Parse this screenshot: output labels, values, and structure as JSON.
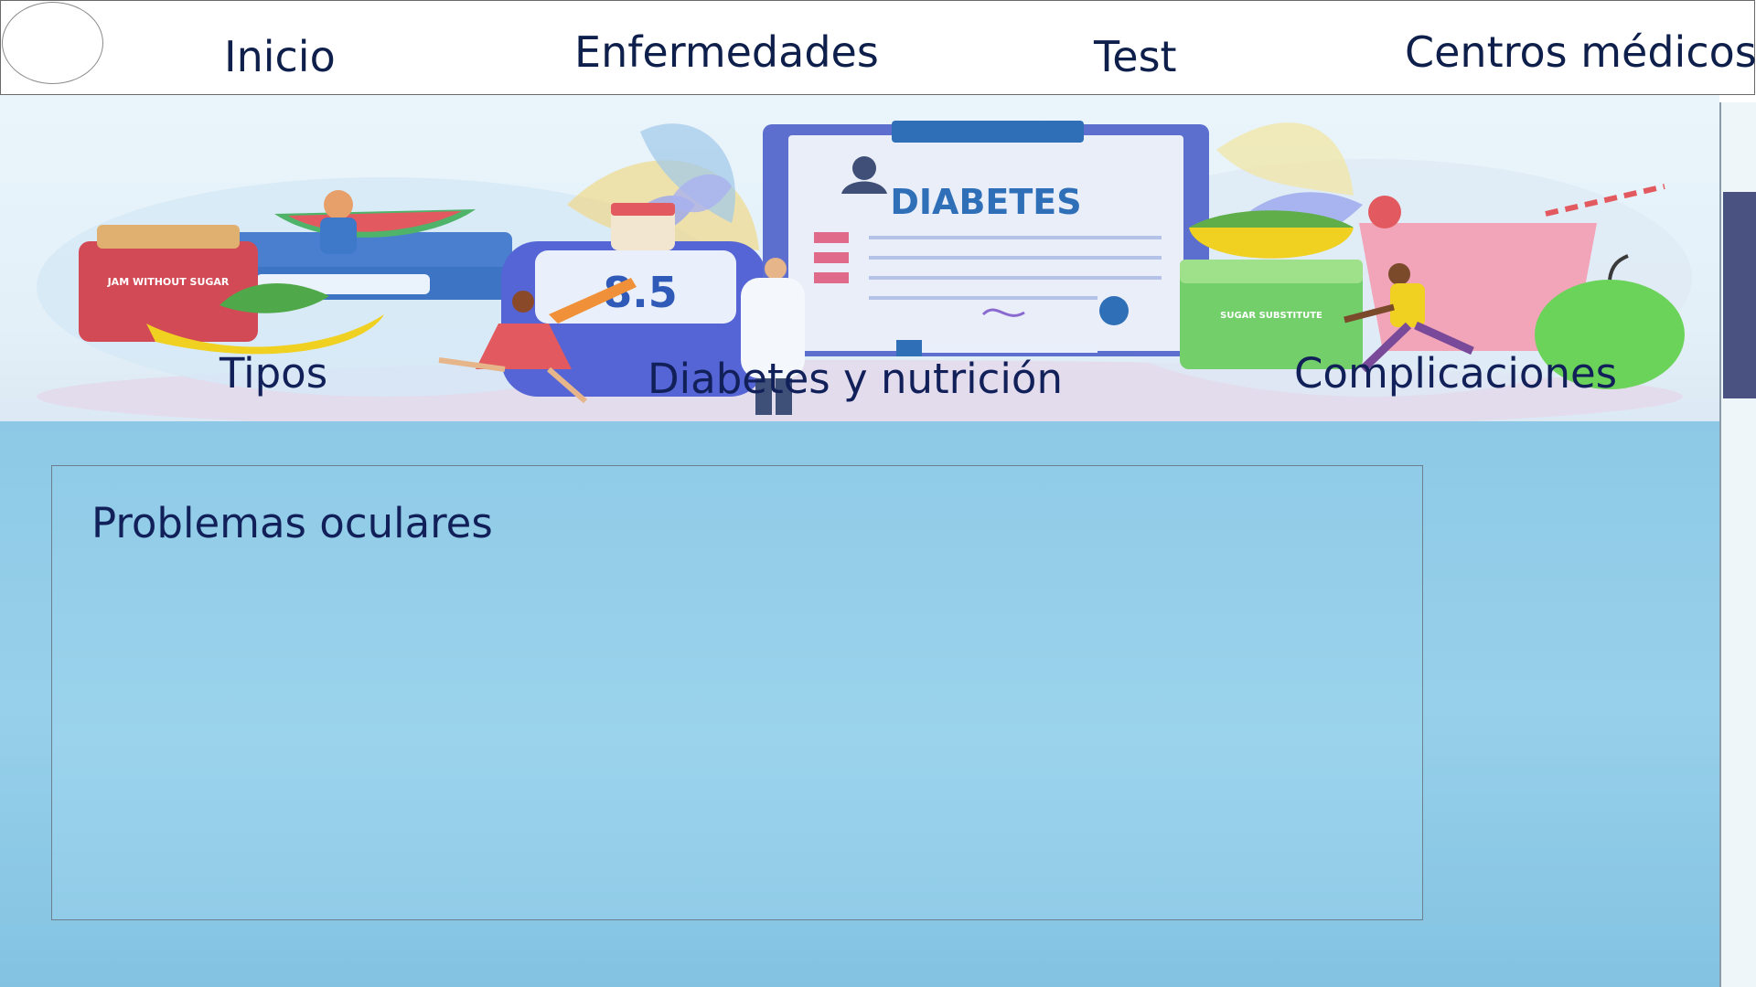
{
  "nav": {
    "items": [
      {
        "label": "Inicio"
      },
      {
        "label": "Enfermedades"
      },
      {
        "label": "Test"
      },
      {
        "label": "Centros médicos"
      }
    ]
  },
  "hero": {
    "banner_text": "DIABETES",
    "meter_reading": "8.5",
    "jam_label": "JAM WITHOUT SUGAR",
    "sugar_label": "SUGAR SUBSTITUTE",
    "links": [
      {
        "label": "Tipos"
      },
      {
        "label": "Diabetes y nutrición"
      },
      {
        "label": "Complicaciones"
      }
    ]
  },
  "panel": {
    "title": "Problemas oculares"
  },
  "colors": {
    "nav_text": "#0d1f4a",
    "link_text": "#12205a",
    "main_bg": "#8dc9e6",
    "scroll_thumb": "#4a5282",
    "banner_blue": "#2f6fb8"
  }
}
